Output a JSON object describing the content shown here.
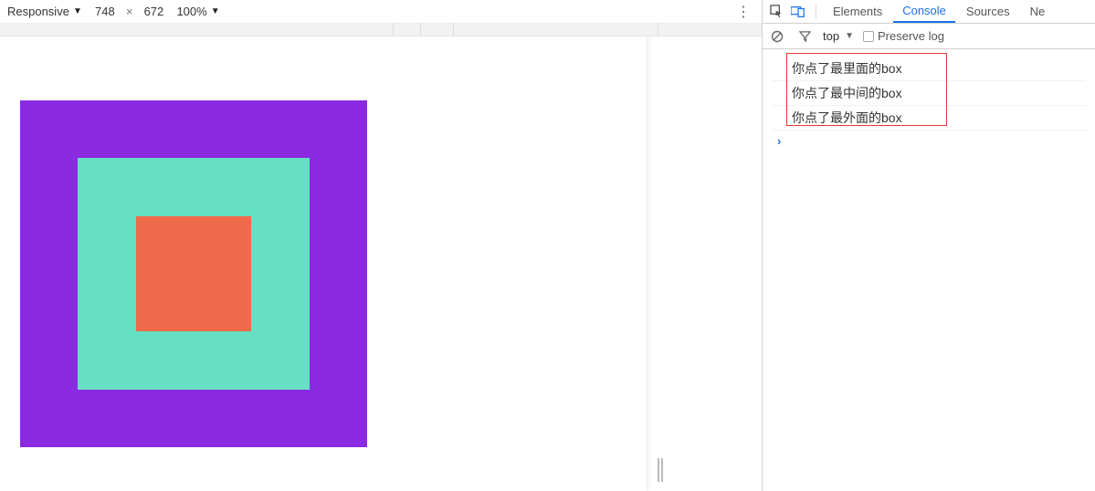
{
  "device_toolbar": {
    "mode_label": "Responsive",
    "width": "748",
    "separator": "×",
    "height": "672",
    "zoom": "100%",
    "kebab": "⋮"
  },
  "boxes": {
    "outer_color": "#8a2be2",
    "middle_color": "#66e0c2",
    "inner_color": "#ef6a4a"
  },
  "devtools": {
    "tabs": {
      "elements": "Elements",
      "console": "Console",
      "sources": "Sources",
      "next": "Ne"
    },
    "active_tab": "Console",
    "console_bar": {
      "context": "top",
      "preserve_log": "Preserve log"
    },
    "console_lines": [
      "你点了最里面的box",
      "你点了最中间的box",
      "你点了最外面的box"
    ],
    "prompt_glyph": "›"
  }
}
